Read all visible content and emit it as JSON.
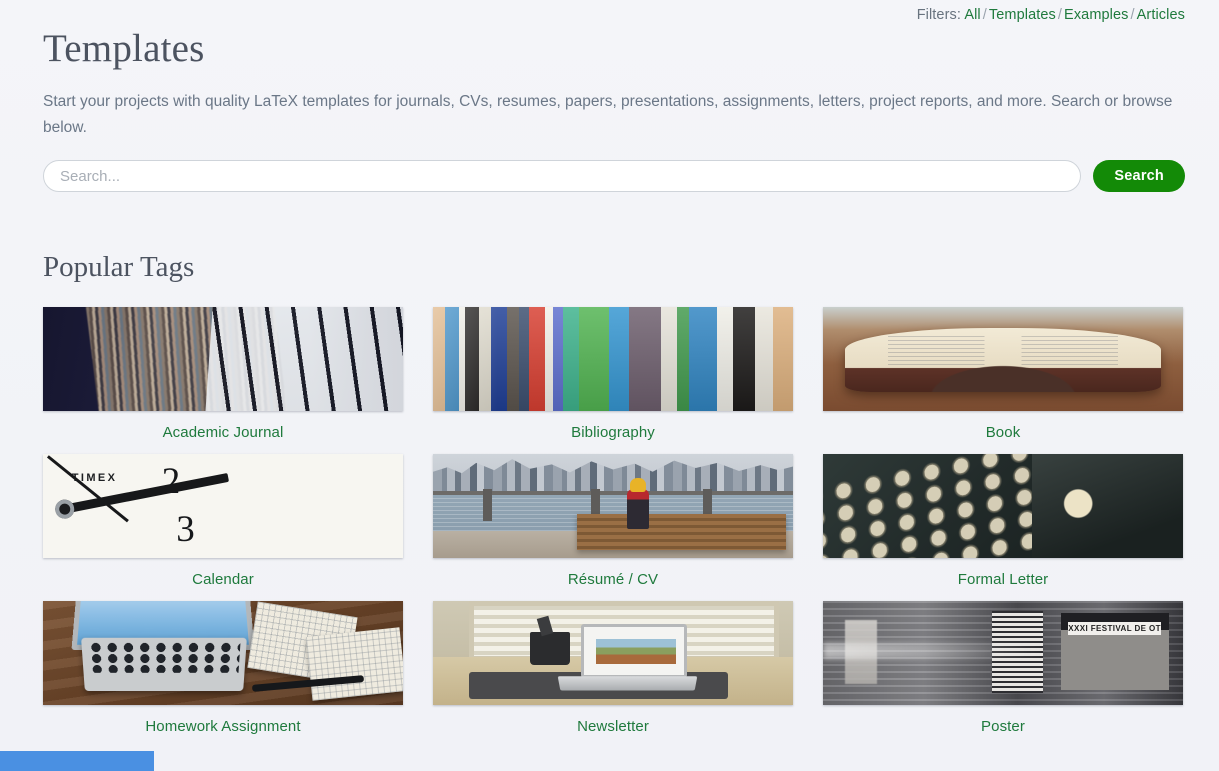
{
  "filters": {
    "label": "Filters:",
    "separator": "/",
    "items": [
      {
        "label": "All"
      },
      {
        "label": "Templates"
      },
      {
        "label": "Examples"
      },
      {
        "label": "Articles"
      }
    ]
  },
  "header": {
    "title": "Templates",
    "description": "Start your projects with quality LaTeX templates for journals, CVs, resumes, papers, presentations, assignments, letters, project reports, and more. Search or browse below."
  },
  "search": {
    "placeholder": "Search...",
    "value": "",
    "button_label": "Search",
    "button_color": "#138a07"
  },
  "popular_tags": {
    "title": "Popular Tags",
    "cards": [
      {
        "label": "Academic Journal",
        "image": "library-bookshelves-photo"
      },
      {
        "label": "Bibliography",
        "image": "colorful-book-spines-photo"
      },
      {
        "label": "Book",
        "image": "open-book-on-table-photo"
      },
      {
        "label": "Calendar",
        "image": "timex-clock-face-photo"
      },
      {
        "label": "Résumé / CV",
        "image": "person-on-bench-city-skyline-photo"
      },
      {
        "label": "Formal Letter",
        "image": "vintage-typewriter-keys-photo"
      },
      {
        "label": "Homework Assignment",
        "image": "laptop-notebooks-desk-photo"
      },
      {
        "label": "Newsletter",
        "image": "laptop-by-window-desk-photo"
      },
      {
        "label": "Poster",
        "image": "blurred-poster-wall-photo"
      }
    ]
  },
  "artwork_text": {
    "clock_brand": "TIMEX",
    "clock_numeral_2": "2",
    "clock_numeral_3": "3",
    "poster_band": "XXXI FESTIVAL DE OT"
  },
  "theme": {
    "background": "#f3f4f8",
    "link_green": "#1f7a3d",
    "title_gray": "#4c5360",
    "body_gray": "#6b7787"
  }
}
